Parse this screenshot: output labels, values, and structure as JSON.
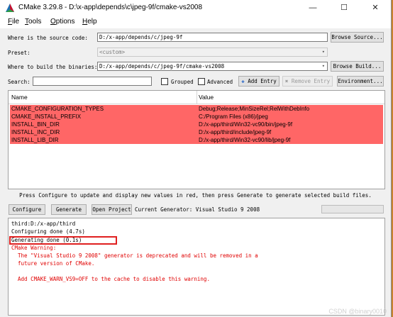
{
  "window": {
    "title": "CMake 3.29.8 - D:\\x-app\\depends\\c\\jpeg-9f/cmake-vs2008",
    "minimize_glyph": "—",
    "maximize_glyph": "☐",
    "close_glyph": "✕"
  },
  "menu": {
    "file": "ile",
    "file_key": "F",
    "tools": "ools",
    "tools_key": "T",
    "options": "ptions",
    "options_key": "O",
    "help": "elp",
    "help_key": "H"
  },
  "source": {
    "label": "Where is the source code:",
    "value": "D:/x-app/depends/c/jpeg-9f",
    "browse_label": "Browse Source..."
  },
  "preset": {
    "label": "Preset:",
    "value": "<custom>"
  },
  "build": {
    "label": "Where to build the binaries:",
    "value": "D:/x-app/depends/c/jpeg-9f/cmake-vs2008",
    "browse_label": "Browse Build..."
  },
  "search": {
    "label": "Search:",
    "value": "",
    "grouped_label": "Grouped",
    "advanced_label": "Advanced",
    "add_entry_label": "Add Entry",
    "remove_entry_label": "Remove Entry",
    "environment_label": "Environment..."
  },
  "table": {
    "col_name": "Name",
    "col_value": "Value",
    "rows": [
      {
        "name": "CMAKE_CONFIGURATION_TYPES",
        "value": "Debug;Release;MinSizeRel;RelWithDebInfo"
      },
      {
        "name": "CMAKE_INSTALL_PREFIX",
        "value": "C:/Program Files (x86)/jpeg"
      },
      {
        "name": "INSTALL_BIN_DIR",
        "value": "D:/x-app/third/Win32-vc90/bin/jpeg-9f"
      },
      {
        "name": "INSTALL_INC_DIR",
        "value": "D:/x-app/third/include/jpeg-9f"
      },
      {
        "name": "INSTALL_LIB_DIR",
        "value": "D:/x-app/third/Win32-vc90/lib/jpeg-9f"
      }
    ]
  },
  "hint": "Press Configure to update and display new values in red, then press Generate to generate selected build files.",
  "actions": {
    "configure_label": "Configure",
    "generate_label": "Generate",
    "open_project_label": "Open Project",
    "current_generator": "Current Generator: Visual Studio 9 2008"
  },
  "output": {
    "lines": [
      "third:D:/x-app/third",
      "Configuring done (4.7s)",
      "Generating done (0.1s)",
      "CMake Warning:",
      "  The \"Visual Studio 9 2008\" generator is deprecated and will be removed in a",
      "  future version of CMake.",
      "",
      "  Add CMAKE_WARN_VS9=OFF to the cache to disable this warning."
    ]
  },
  "watermark": "CSDN @binary0010",
  "colors": {
    "changed_row": "#ff6666",
    "warning_text": "#e00000",
    "highlight": "#e02020"
  }
}
